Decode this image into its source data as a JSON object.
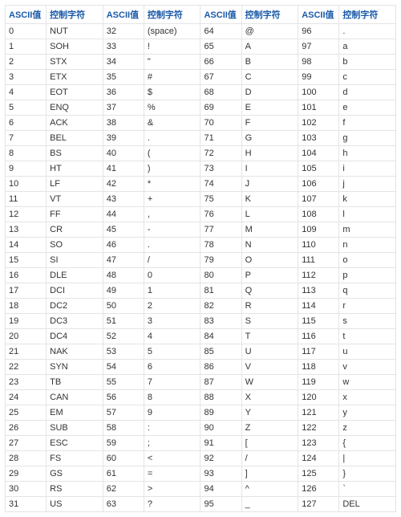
{
  "headers": {
    "value": "ASCII值",
    "char": "控制字符"
  },
  "rows": [
    [
      "0",
      "NUT",
      "32",
      "(space)",
      "64",
      "@",
      "96",
      "."
    ],
    [
      "1",
      "SOH",
      "33",
      "!",
      "65",
      "A",
      "97",
      "a"
    ],
    [
      "2",
      "STX",
      "34",
      "\"",
      "66",
      "B",
      "98",
      "b"
    ],
    [
      "3",
      "ETX",
      "35",
      "#",
      "67",
      "C",
      "99",
      "c"
    ],
    [
      "4",
      "EOT",
      "36",
      "$",
      "68",
      "D",
      "100",
      "d"
    ],
    [
      "5",
      "ENQ",
      "37",
      "%",
      "69",
      "E",
      "101",
      "e"
    ],
    [
      "6",
      "ACK",
      "38",
      "&",
      "70",
      "F",
      "102",
      "f"
    ],
    [
      "7",
      "BEL",
      "39",
      ".",
      "71",
      "G",
      "103",
      "g"
    ],
    [
      "8",
      "BS",
      "40",
      "(",
      "72",
      "H",
      "104",
      "h"
    ],
    [
      "9",
      "HT",
      "41",
      ")",
      "73",
      "I",
      "105",
      "i"
    ],
    [
      "10",
      "LF",
      "42",
      "*",
      "74",
      "J",
      "106",
      "j"
    ],
    [
      "11",
      "VT",
      "43",
      "+",
      "75",
      "K",
      "107",
      "k"
    ],
    [
      "12",
      "FF",
      "44",
      ",",
      "76",
      "L",
      "108",
      "l"
    ],
    [
      "13",
      "CR",
      "45",
      "-",
      "77",
      "M",
      "109",
      "m"
    ],
    [
      "14",
      "SO",
      "46",
      ".",
      "78",
      "N",
      "110",
      "n"
    ],
    [
      "15",
      "SI",
      "47",
      "/",
      "79",
      "O",
      "111",
      "o"
    ],
    [
      "16",
      "DLE",
      "48",
      "0",
      "80",
      "P",
      "112",
      "p"
    ],
    [
      "17",
      "DCI",
      "49",
      "1",
      "81",
      "Q",
      "113",
      "q"
    ],
    [
      "18",
      "DC2",
      "50",
      "2",
      "82",
      "R",
      "114",
      "r"
    ],
    [
      "19",
      "DC3",
      "51",
      "3",
      "83",
      "S",
      "115",
      "s"
    ],
    [
      "20",
      "DC4",
      "52",
      "4",
      "84",
      "T",
      "116",
      "t"
    ],
    [
      "21",
      "NAK",
      "53",
      "5",
      "85",
      "U",
      "117",
      "u"
    ],
    [
      "22",
      "SYN",
      "54",
      "6",
      "86",
      "V",
      "118",
      "v"
    ],
    [
      "23",
      "TB",
      "55",
      "7",
      "87",
      "W",
      "119",
      "w"
    ],
    [
      "24",
      "CAN",
      "56",
      "8",
      "88",
      "X",
      "120",
      "x"
    ],
    [
      "25",
      "EM",
      "57",
      "9",
      "89",
      "Y",
      "121",
      "y"
    ],
    [
      "26",
      "SUB",
      "58",
      ":",
      "90",
      "Z",
      "122",
      "z"
    ],
    [
      "27",
      "ESC",
      "59",
      ";",
      "91",
      "[",
      "123",
      "{"
    ],
    [
      "28",
      "FS",
      "60",
      "<",
      "92",
      "/",
      "124",
      "|"
    ],
    [
      "29",
      "GS",
      "61",
      "=",
      "93",
      "]",
      "125",
      "}"
    ],
    [
      "30",
      "RS",
      "62",
      ">",
      "94",
      "^",
      "126",
      "`"
    ],
    [
      "31",
      "US",
      "63",
      "?",
      "95",
      "_",
      "127",
      "DEL"
    ]
  ]
}
